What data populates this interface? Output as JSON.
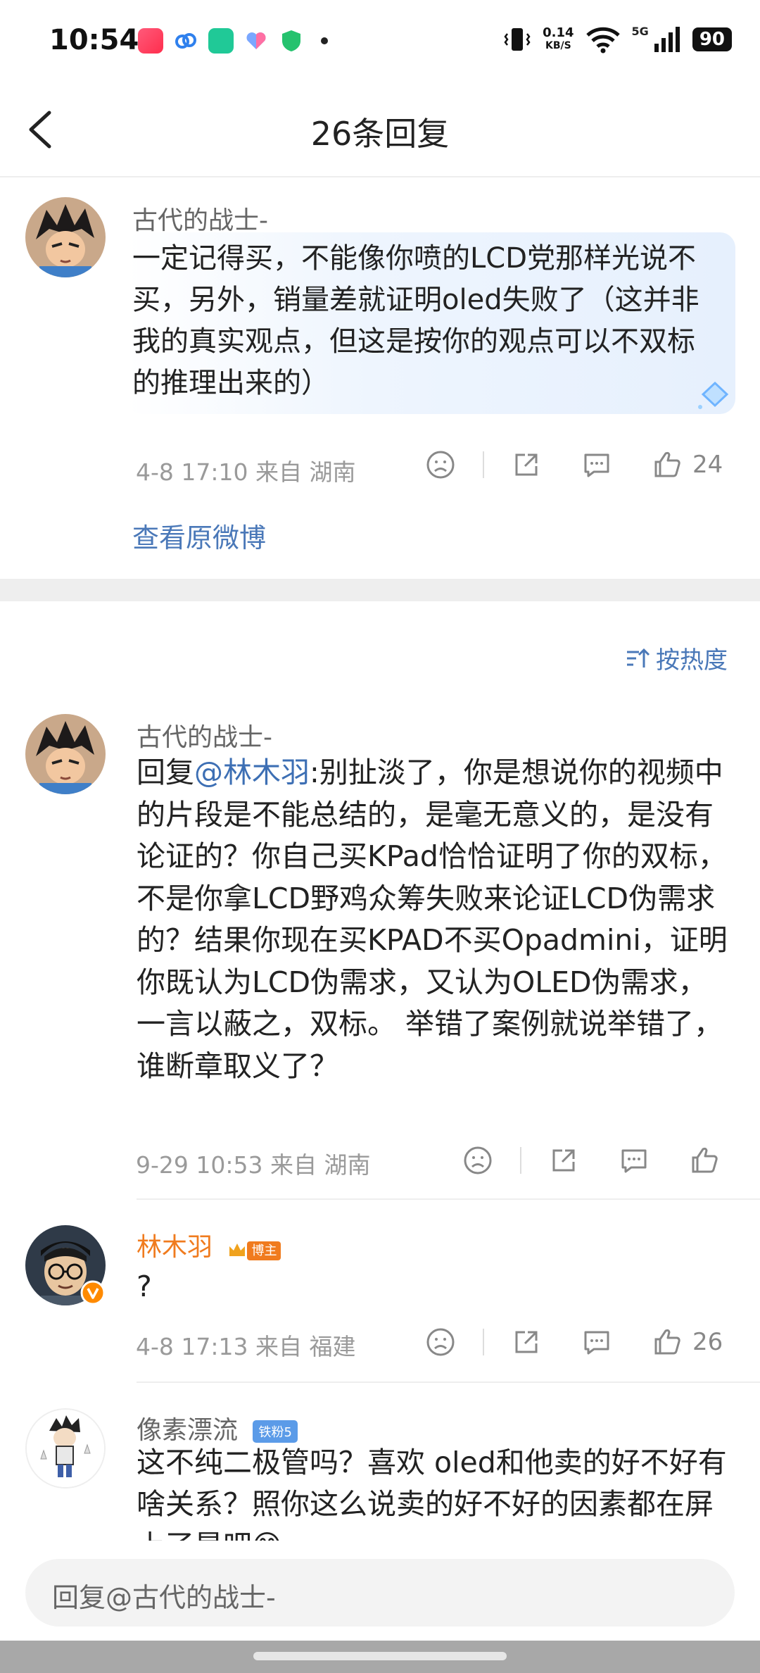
{
  "status_bar": {
    "time": "10:54",
    "net_speed_value": "0.14",
    "net_speed_unit": "KB/S",
    "signal_label": "5G",
    "battery": "90"
  },
  "nav": {
    "title": "26条回复"
  },
  "root_comment": {
    "username": "古代的战士-",
    "text": "一定记得买，不能像你喷的LCD党那样光说不买，另外，销量差就证明oled失败了（这并非我的真实观点，但这是按你的观点可以不双标的推理出来的）",
    "time_location": "4-8 17:10  来自 湖南",
    "likes": "24",
    "view_original": "查看原微博"
  },
  "sort": {
    "label": "按热度"
  },
  "replies": [
    {
      "username": "古代的战士-",
      "reply_prefix": "回复",
      "mention": "@林木羽",
      "text": ":别扯淡了，你是想说你的视频中的片段是不能总结的，是毫无意义的，是没有论证的？你自己买KPad恰恰证明了你的双标，不是你拿LCD野鸡众筹失败来论证LCD伪需求的？结果你现在买KPAD不买Opadmini，证明你既认为LCD伪需求，又认为OLED伪需求，一言以蔽之，双标。 举错了案例就说举错了，谁断章取义了？",
      "time_location": "9-29 10:53  来自 湖南"
    },
    {
      "username": "林木羽",
      "badge": "博主",
      "text": "?",
      "time_location": "4-8 17:13  来自 福建",
      "likes": "26"
    },
    {
      "username": "像素漂流",
      "badge": "铁粉5",
      "text": "这不纯二极管吗？喜欢 oled和他卖的好不好有啥关系？照你这么说卖的好不好的因素都在屏上了是吧😊"
    }
  ],
  "input": {
    "placeholder": "回复@古代的战士-"
  },
  "colors": {
    "link_blue": "#4a78b8",
    "blogger_orange": "#f07b1e",
    "fan_blue": "#5b9be8"
  }
}
